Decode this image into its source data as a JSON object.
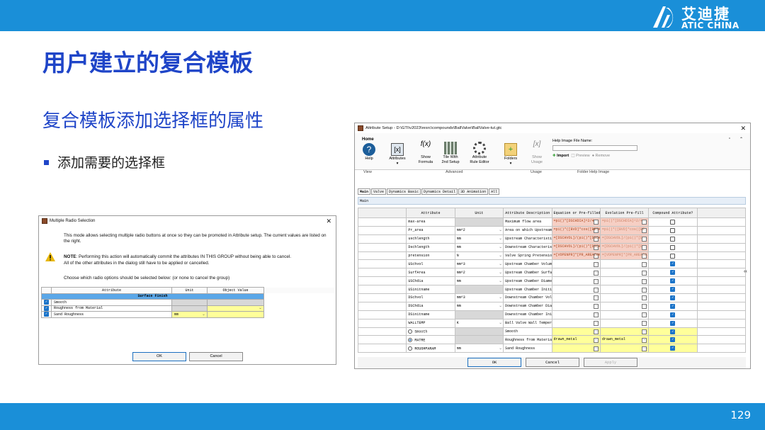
{
  "slide": {
    "title": "用户建立的复合模板",
    "subtitle": "复合模板添加选择框的属性",
    "bullet": "添加需要的选择框",
    "page_number": "129"
  },
  "logo": {
    "cn": "艾迪捷",
    "en": "ATIC CHINA"
  },
  "colors": {
    "brand": "#1a8fd8",
    "title": "#1f45c8"
  },
  "dialog": {
    "title": "Multiple Radio Selection",
    "text1": "This mode allows selecting multiple radio buttons at once so they can be promoted in Attribute setup. The current values are listed on the right.",
    "note_label": "NOTE",
    "note": ": Performing this action will automatically commit the attributes IN THIS GROUP without being able to cancel.",
    "note2": "All of the other attributes in the dialog still have to be applied or cancelled.",
    "prompt": "Choose which radio options should be selected below: (or none to cancel the group)",
    "headers": [
      "Attribute",
      "Unit",
      "Object Value"
    ],
    "group": "Surface Finish",
    "rows": [
      {
        "name": "Smooth",
        "unit": ""
      },
      {
        "name": "Roughness from Material",
        "unit": ""
      },
      {
        "name": "Sand Roughness",
        "unit": "mm"
      }
    ],
    "ok": "OK",
    "cancel": "Cancel"
  },
  "setup": {
    "title": "Attribute Setup - D:\\GTI\\v2023\\resrc\\compounds\\BallValve\\BallValve-tut.gtc",
    "home_tab": "Home",
    "ribbon": {
      "help": "Help",
      "view": "View",
      "attributes": "Attributes",
      "show_formula": "Show",
      "formula": "Formula",
      "tile": "Tile With",
      "second_setup": "2nd Setup",
      "attr_rule": "Attribute",
      "rule_editor": "Rule Editor",
      "folders": "Folders",
      "show": "Show",
      "usage": "Usage",
      "advanced": "Advanced",
      "usage_group": "Usage",
      "help_image_label": "Help Image File Name:",
      "import": "Import",
      "preview": "Preview",
      "remove": "Remove",
      "folder_help": "Folder Help Image"
    },
    "tabs": [
      "Main",
      "Valve",
      "Dynamics Basic",
      "Dynamics Detail",
      "3D Animation",
      "All"
    ],
    "section": "Main",
    "headers": [
      "Attribute",
      "Unit",
      "Attribute Description",
      "Equation or Pre-filled Value",
      "Evolution Pre-fill",
      "Compound Attribute?"
    ],
    "rows": [
      {
        "attr": "max-area",
        "unit": "",
        "desc": "Maximum flow area",
        "eq": "=pi()*[DSCHDIA]^2/4",
        "evo": "=pi()*[DSCHDIA]^2/4",
        "checked": false,
        "style": "pink"
      },
      {
        "attr": "Pr_area",
        "unit": "mm^2",
        "desc": "Area on which Upstream and D...",
        "eq": "=pi()*([BVD]*cos([BETA]))^",
        "evo": "=pi()*([BVD]*cos([BE",
        "checked": false,
        "style": "pink"
      },
      {
        "attr": "uschlength",
        "unit": "mm",
        "desc": "Upstream Characteristic Length",
        "eq": "=[DSCHVOL]/(pi()*[DSCHDIA",
        "evo": "=[DSCHVOL]/(pi()*[D",
        "checked": false,
        "style": "pink"
      },
      {
        "attr": "Dschlength",
        "unit": "mm",
        "desc": "Downstream Characteristic Le...",
        "eq": "=[DSCHVOL]/(pi()*[DSCHDIA",
        "evo": "=[DSCHVOL]/(pi()*[D",
        "checked": false,
        "style": "pink"
      },
      {
        "attr": "pretension",
        "unit": "N",
        "desc": "Valve Spring Pretension",
        "eq": "=[VOPENPR]*[PR_AREA(mm^2)]/10",
        "evo": "=[VOPENPR]*[PR_AREA(m",
        "checked": false,
        "style": "pink"
      },
      {
        "attr": "USchvol",
        "unit": "mm^3",
        "desc": "Upstream Chamber Volume",
        "eq": "",
        "evo": "",
        "checked": true,
        "style": ""
      },
      {
        "attr": "SurfArea",
        "unit": "mm^2",
        "desc": "Upstream Chamber Surface Area",
        "eq": "",
        "evo": "",
        "checked": true,
        "style": ""
      },
      {
        "attr": "USChdia",
        "unit": "mm",
        "desc": "Upstream Chamber Diameter",
        "eq": "",
        "evo": "",
        "checked": true,
        "style": ""
      },
      {
        "attr": "USinitname",
        "unit": "",
        "desc": "Upstream Chamber Initial Sta...",
        "eq": "",
        "evo": "",
        "checked": true,
        "style": ""
      },
      {
        "attr": "DSchvol",
        "unit": "mm^3",
        "desc": "Downstream Chamber Volume",
        "eq": "",
        "evo": "",
        "checked": true,
        "style": ""
      },
      {
        "attr": "DSChdia",
        "unit": "mm",
        "desc": "Downstream Chamber Diameter",
        "eq": "",
        "evo": "",
        "checked": true,
        "style": ""
      },
      {
        "attr": "DSinitname",
        "unit": "",
        "desc": "Downstream Chamber Initial S...",
        "eq": "",
        "evo": "",
        "checked": true,
        "style": ""
      },
      {
        "attr": "WALLTEMP",
        "unit": "K",
        "desc": "Ball Valve Wall Temperature",
        "eq": "",
        "evo": "",
        "checked": true,
        "style": ""
      },
      {
        "attr": "Smooth",
        "unit": "",
        "desc": "Smooth",
        "eq": "",
        "evo": "",
        "checked": true,
        "style": "radio"
      },
      {
        "attr": "MATRE",
        "unit": "",
        "desc": "Roughness from Material",
        "eq": "drawn_metal",
        "evo": "drawn_metal",
        "checked": true,
        "style": "radio-on"
      },
      {
        "attr": "ROUGHPARAM",
        "unit": "mm",
        "desc": "Sand Roughness",
        "eq": "",
        "evo": "",
        "checked": true,
        "style": "radio"
      }
    ],
    "ok": "OK",
    "cancel": "Cancel",
    "apply": "Apply"
  }
}
